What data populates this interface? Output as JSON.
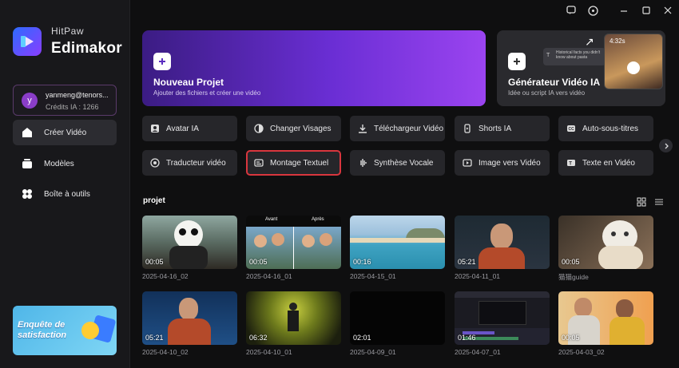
{
  "app": {
    "brand_top": "HitPaw",
    "brand_bottom": "Edimakor"
  },
  "account": {
    "initial": "y",
    "name": "yanmeng@tenors...",
    "credits": "Crédits IA : 1266"
  },
  "sidebar": {
    "items": [
      {
        "label": "Créer Vidéo",
        "icon": "home-icon",
        "active": true
      },
      {
        "label": "Modèles",
        "icon": "templates-icon",
        "active": false
      },
      {
        "label": "Boîte à outils",
        "icon": "toolbox-icon",
        "active": false
      }
    ],
    "survey": "Enquête de satisfaction"
  },
  "hero": {
    "new_project": {
      "title": "Nouveau Projet",
      "subtitle": "Ajouter des fichiers et créer une vidéo"
    },
    "generator": {
      "title": "Générateur Vidéo IA",
      "subtitle": "Idée ou script IA vers vidéo",
      "preview_time": "4:32s",
      "prompt_text": "Historical facts you didn't know about pasta"
    }
  },
  "tools": [
    {
      "label": "Avatar IA",
      "icon": "avatar-icon"
    },
    {
      "label": "Changer Visages",
      "icon": "face-swap-icon"
    },
    {
      "label": "Téléchargeur Vidéo",
      "icon": "download-icon"
    },
    {
      "label": "Shorts IA",
      "icon": "shorts-icon"
    },
    {
      "label": "Auto-sous-titres",
      "icon": "subtitles-icon"
    },
    {
      "label": "Traducteur vidéo",
      "icon": "translate-icon"
    },
    {
      "label": "Montage Textuel",
      "icon": "text-edit-icon",
      "selected": true
    },
    {
      "label": "Synthèse Vocale",
      "icon": "voice-icon"
    },
    {
      "label": "Image vers Vidéo",
      "icon": "image-video-icon"
    },
    {
      "label": "Texte en Vidéo",
      "icon": "text-video-icon"
    }
  ],
  "projects": {
    "title": "projet",
    "items": [
      {
        "name": "2025-04-16_02",
        "duration": "00:05"
      },
      {
        "name": "2025-04-16_01",
        "duration": "00:05",
        "labels": [
          "Avant",
          "Après"
        ]
      },
      {
        "name": "2025-04-15_01",
        "duration": "00:16"
      },
      {
        "name": "2025-04-11_01",
        "duration": "05:21"
      },
      {
        "name": "猫猫guide",
        "duration": "00:05"
      },
      {
        "name": "2025-04-10_02",
        "duration": "05:21"
      },
      {
        "name": "2025-04-10_01",
        "duration": "06:32"
      },
      {
        "name": "2025-04-09_01",
        "duration": "02:01"
      },
      {
        "name": "2025-04-07_01",
        "duration": "01:46"
      },
      {
        "name": "2025-04-03_02",
        "duration": "00:05"
      }
    ]
  },
  "colors": {
    "accent_purple": "#7a35e0",
    "selected_border": "#d9363e",
    "background": "#0f0f10"
  }
}
